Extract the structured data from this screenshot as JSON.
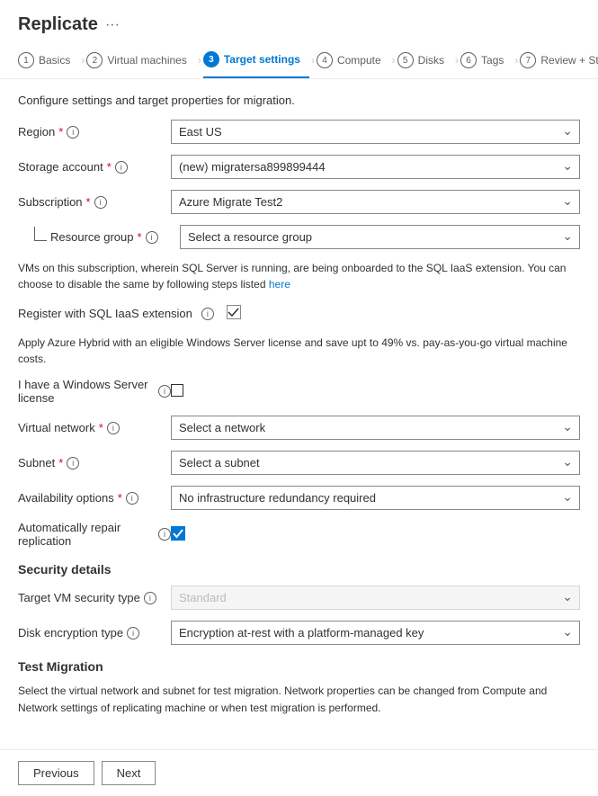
{
  "page": {
    "title": "Replicate",
    "description": "Configure settings and target properties for migration."
  },
  "wizard": {
    "steps": [
      {
        "number": "1",
        "label": "Basics",
        "active": false
      },
      {
        "number": "2",
        "label": "Virtual machines",
        "active": false
      },
      {
        "number": "3",
        "label": "Target settings",
        "active": true
      },
      {
        "number": "4",
        "label": "Compute",
        "active": false
      },
      {
        "number": "5",
        "label": "Disks",
        "active": false
      },
      {
        "number": "6",
        "label": "Tags",
        "active": false
      },
      {
        "number": "7",
        "label": "Review + Start replication",
        "active": false
      }
    ]
  },
  "form": {
    "region": {
      "label": "Region",
      "required": true,
      "value": "East US"
    },
    "storage_account": {
      "label": "Storage account",
      "required": true,
      "value": "(new) migratersa899899444"
    },
    "subscription": {
      "label": "Subscription",
      "required": true,
      "value": "Azure Migrate Test2"
    },
    "resource_group": {
      "label": "Resource group",
      "required": true,
      "placeholder": "Select a resource group"
    },
    "sql_notice": "VMs on this subscription, wherein SQL Server is running, are being onboarded to the SQL IaaS extension. You can choose to disable the same by following steps listed",
    "sql_link_text": "here",
    "register_sql": {
      "label": "Register with SQL IaaS extension",
      "checked": true
    },
    "hybrid_notice": "Apply Azure Hybrid with an eligible Windows Server license and save upt to 49% vs. pay-as-you-go virtual machine costs.",
    "windows_license": {
      "label": "I have a Windows Server license",
      "checked": false
    },
    "virtual_network": {
      "label": "Virtual network",
      "required": true,
      "placeholder": "Select a network"
    },
    "subnet": {
      "label": "Subnet",
      "required": true,
      "placeholder": "Select a subnet"
    },
    "availability_options": {
      "label": "Availability options",
      "required": true,
      "value": "No infrastructure redundancy required"
    },
    "auto_repair": {
      "label": "Automatically repair replication",
      "checked": true
    },
    "security_section": "Security details",
    "target_vm_security": {
      "label": "Target VM security type",
      "placeholder": "Standard",
      "disabled": true
    },
    "disk_encryption": {
      "label": "Disk encryption type",
      "value": "Encryption at-rest with a platform-managed key"
    },
    "test_migration_section": "Test Migration",
    "test_migration_notice": "Select the virtual network and subnet for test migration. Network properties can be changed from Compute and Network settings of replicating machine or when test migration is performed.",
    "test_migration_link1": "Compute and Network",
    "buttons": {
      "previous": "Previous",
      "next": "Next"
    }
  }
}
